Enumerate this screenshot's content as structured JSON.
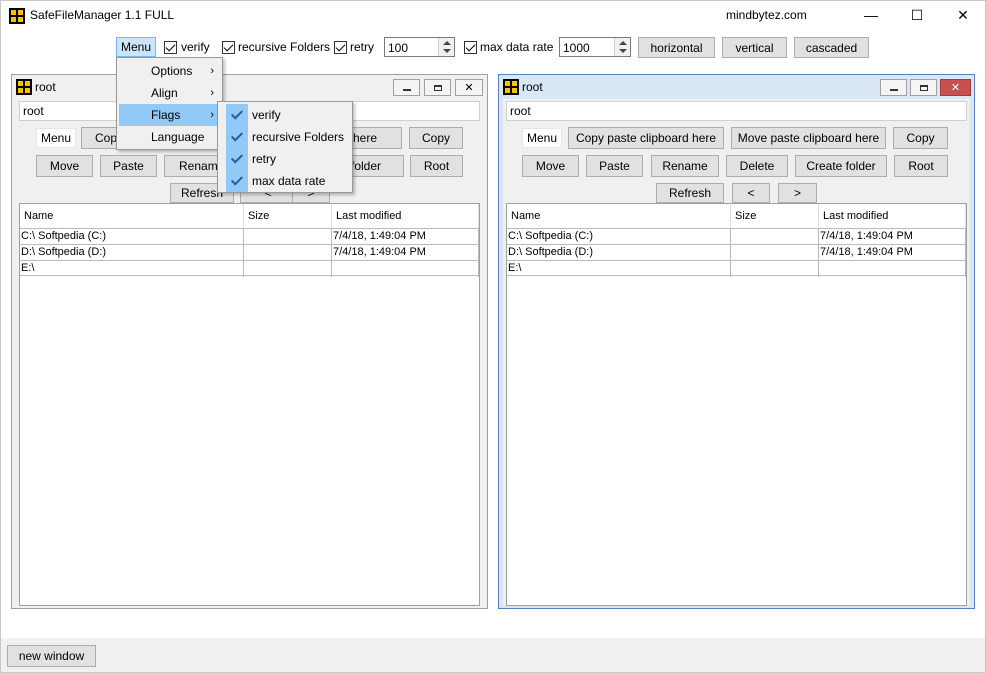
{
  "window": {
    "title": "SafeFileManager 1.1 FULL",
    "site": "mindbytez.com",
    "min_glyph": "—",
    "max_glyph": "☐",
    "close_glyph": "✕"
  },
  "toolbar": {
    "menu_label": "Menu",
    "verify_label": "verify",
    "recursive_label": "recursive Folders",
    "retry_label": "retry",
    "retry_value": "100",
    "maxrate_label": "max data rate",
    "maxrate_value": "1000",
    "horizontal_label": "horizontal",
    "vertical_label": "vertical",
    "cascaded_label": "cascaded"
  },
  "menu": {
    "items": [
      {
        "label": "Options"
      },
      {
        "label": "Align"
      },
      {
        "label": "Flags"
      },
      {
        "label": "Language"
      }
    ],
    "submenu_arrow": "›",
    "flags": [
      {
        "label": "verify"
      },
      {
        "label": "recursive Folders"
      },
      {
        "label": "retry"
      },
      {
        "label": "max data rate"
      }
    ]
  },
  "left_pane": {
    "title": "root",
    "path": "root",
    "menu_label": "Menu",
    "copy_clip_label": "Copy",
    "move_clip_label": "rd here",
    "copy_label": "Copy",
    "move_label": "Move",
    "paste_label": "Paste",
    "rename_label": "Rename",
    "create_label": "e folder",
    "root_label": "Root",
    "refresh_label": "Refresh",
    "back_label": "<",
    "fwd_label": ">",
    "columns": {
      "name": "Name",
      "size": "Size",
      "modified": "Last modified"
    },
    "rows": [
      {
        "name": "C:\\ Softpedia (C:)",
        "size": "",
        "modified": "7/4/18,  1:49:04 PM"
      },
      {
        "name": "D:\\ Softpedia (D:)",
        "size": "",
        "modified": "7/4/18,  1:49:04 PM"
      },
      {
        "name": "E:\\",
        "size": "",
        "modified": ""
      }
    ]
  },
  "right_pane": {
    "title": "root",
    "path": "root",
    "menu_label": "Menu",
    "copy_clip_label": "Copy paste clipboard here",
    "move_clip_label": "Move paste clipboard here",
    "copy_label": "Copy",
    "move_label": "Move",
    "paste_label": "Paste",
    "rename_label": "Rename",
    "delete_label": "Delete",
    "create_label": "Create folder",
    "root_label": "Root",
    "refresh_label": "Refresh",
    "back_label": "<",
    "fwd_label": ">",
    "columns": {
      "name": "Name",
      "size": "Size",
      "modified": "Last modified"
    },
    "rows": [
      {
        "name": "C:\\ Softpedia (C:)",
        "size": "",
        "modified": "7/4/18,  1:49:04 PM"
      },
      {
        "name": "D:\\ Softpedia (D:)",
        "size": "",
        "modified": "7/4/18,  1:49:04 PM"
      },
      {
        "name": "E:\\",
        "size": "",
        "modified": ""
      }
    ]
  },
  "footer": {
    "new_window_label": "new window"
  },
  "colors": {
    "menu_highlight": "#91c9f7",
    "active_border": "#5b80c0",
    "close_red": "#c75050"
  }
}
